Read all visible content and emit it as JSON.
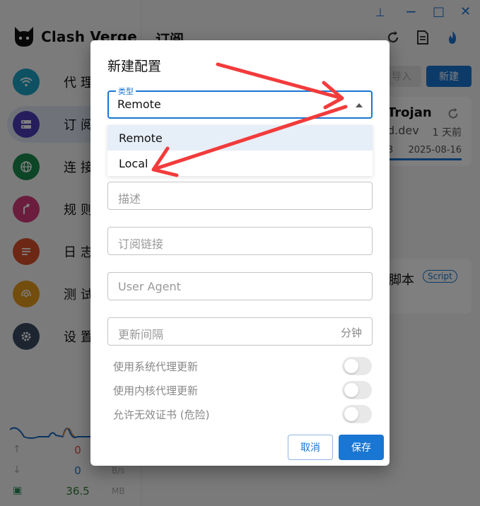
{
  "app": {
    "brand": "Clash Verge",
    "page_title": "订阅",
    "nav": [
      {
        "label": "代理",
        "icon": "wifi-icon",
        "color": "#1aa3c4"
      },
      {
        "label": "订阅",
        "icon": "server-icon",
        "color": "#4c3cb8"
      },
      {
        "label": "连接",
        "icon": "globe-icon",
        "color": "#1b8a4f"
      },
      {
        "label": "规则",
        "icon": "route-icon",
        "color": "#d63b7b"
      },
      {
        "label": "日志",
        "icon": "log-icon",
        "color": "#d8502a"
      },
      {
        "label": "测试",
        "icon": "radar-icon",
        "color": "#e59a1b"
      },
      {
        "label": "设置",
        "icon": "gear-icon",
        "color": "#3b4a63"
      }
    ],
    "traffic": {
      "up": "0",
      "down": "0",
      "down_unit": "B/s",
      "memory": "36.5",
      "memory_unit": "MB"
    },
    "toolbar": {
      "import_label": "导入",
      "new_label": "新建"
    },
    "profile_card": {
      "name": "Trojan",
      "host": "d.dev",
      "ago": "1 天前",
      "date": "2025-08-16",
      "num": "3"
    },
    "script_card": {
      "name": "脚本",
      "badge": "Script"
    }
  },
  "dialog": {
    "title": "新建配置",
    "type_label": "类型",
    "type_value": "Remote",
    "type_options": [
      "Remote",
      "Local"
    ],
    "desc_placeholder": "描述",
    "url_placeholder": "订阅链接",
    "ua_placeholder": "User Agent",
    "interval_placeholder": "更新间隔",
    "interval_suffix": "分钟",
    "switches": [
      {
        "label": "使用系统代理更新",
        "on": false
      },
      {
        "label": "使用内核代理更新",
        "on": false
      },
      {
        "label": "允许无效证书 (危险)",
        "on": false
      }
    ],
    "cancel_label": "取消",
    "save_label": "保存"
  },
  "colors": {
    "accent": "#1976d2",
    "annotation_arrow": "#f23b3b"
  }
}
